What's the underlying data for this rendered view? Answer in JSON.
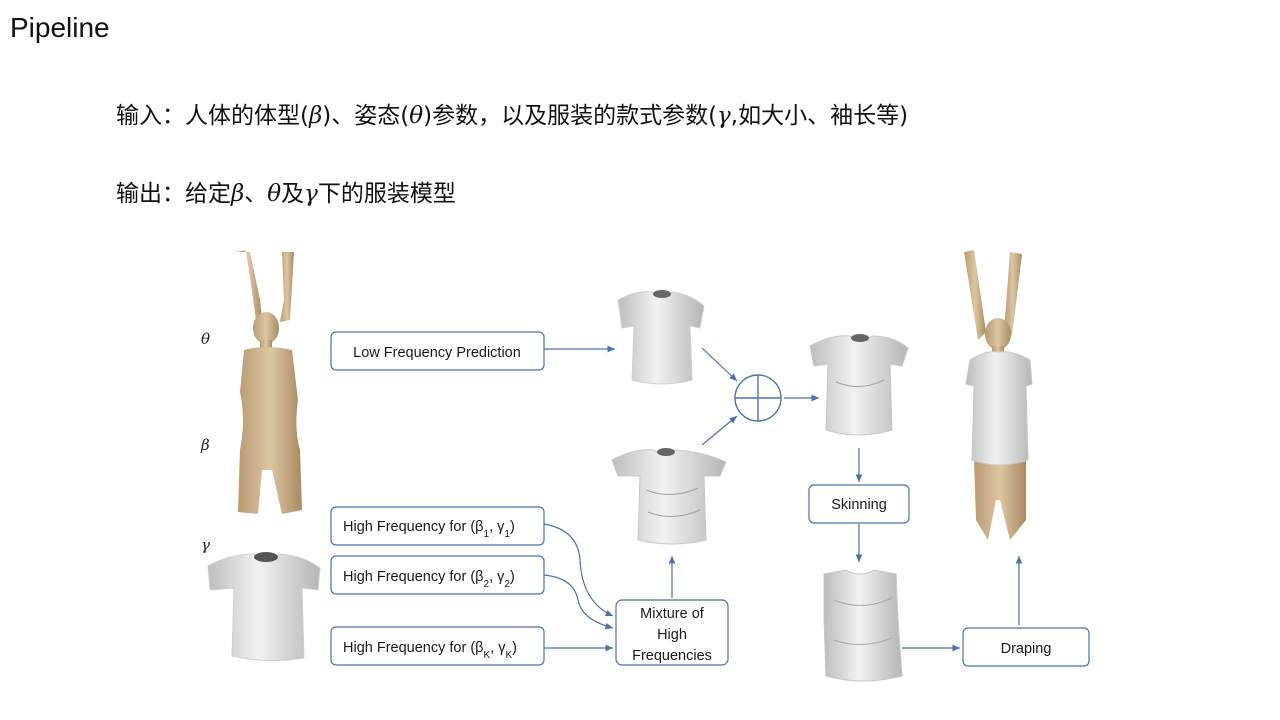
{
  "slide": {
    "title": "Pipeline",
    "input": {
      "label": "输入：",
      "t1": "人体的体型(",
      "beta": "β",
      "t2": ")、姿态(",
      "theta": "θ",
      "t3": ")参数，以及服装的款式参数(",
      "gamma": "γ",
      "t4": ",如大小、袖长等)"
    },
    "output": {
      "label": "输出：",
      "t1": "给定",
      "beta": "β",
      "t2": "、",
      "theta": "θ",
      "t3": "及",
      "gamma": "γ",
      "t4": "下的服装模型"
    }
  },
  "diagram": {
    "params": {
      "theta": "θ",
      "beta": "β",
      "gamma": "γ"
    },
    "boxes": {
      "low_freq": "Low Frequency Prediction",
      "hf_prefix": "High Frequency for (β",
      "hf1_sub": "1",
      "hf2_sub": "2",
      "hfk_sub": "K",
      "hf_mid": ", γ",
      "hf_suffix": ")",
      "mixture_l1": "Mixture of",
      "mixture_l2": "High",
      "mixture_l3": "Frequencies",
      "skinning": "Skinning",
      "draping": "Draping"
    },
    "colors": {
      "box_border": "#4a72b0",
      "arrow": "#4a72b0",
      "skin": "#cdb592",
      "garment": "#e4e4e4"
    }
  }
}
